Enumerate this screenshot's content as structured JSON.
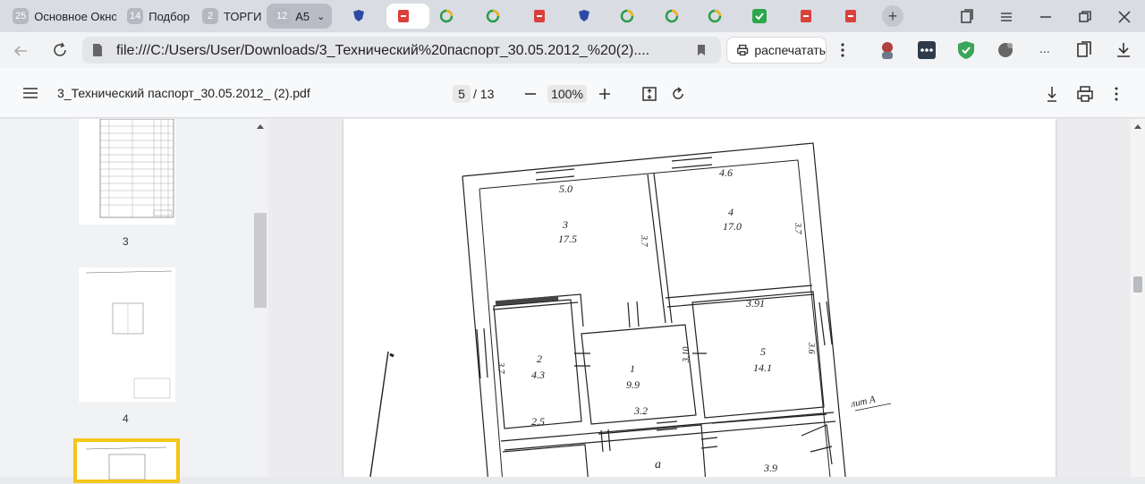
{
  "tabs": {
    "groups": [
      {
        "count": "25",
        "label": "Основное Окно"
      },
      {
        "count": "14",
        "label": "Подбор"
      },
      {
        "count": "2",
        "label": "ТОРГИ"
      },
      {
        "count": "12",
        "label": "А5"
      }
    ]
  },
  "address_bar": {
    "url": "file:///C:/Users/User/Downloads/3_Технический%20паспорт_30.05.2012_%20(2)....",
    "print_label": "распечатать",
    "more_label": "..."
  },
  "pdf_toolbar": {
    "file_name": "3_Технический паспорт_30.05.2012_ (2).pdf",
    "current_page": "5",
    "total_pages": "/ 13",
    "zoom": "100%"
  },
  "thumbnails": {
    "labels": [
      "3",
      "4"
    ]
  },
  "plan": {
    "labels": {
      "top_left_w": "5.0",
      "top_right_w": "4.6",
      "room3": "3",
      "room3_area": "17.5",
      "room4": "4",
      "room4_area": "17.0",
      "dim_37a": "3.7",
      "dim_37b": "3.7",
      "dim_391": "3.91",
      "room2": "2",
      "room2_area": "4.3",
      "room1": "1",
      "room1_area": "9.9",
      "dim_310": "3.10",
      "room5": "5",
      "room5_area": "14.1",
      "dim_36": "3.6",
      "dim_37c": "3.7",
      "dim_25": "2.5",
      "dim_32": "3.2",
      "litA": "лит А",
      "room_a": "а",
      "dim_39": "3.9"
    }
  }
}
